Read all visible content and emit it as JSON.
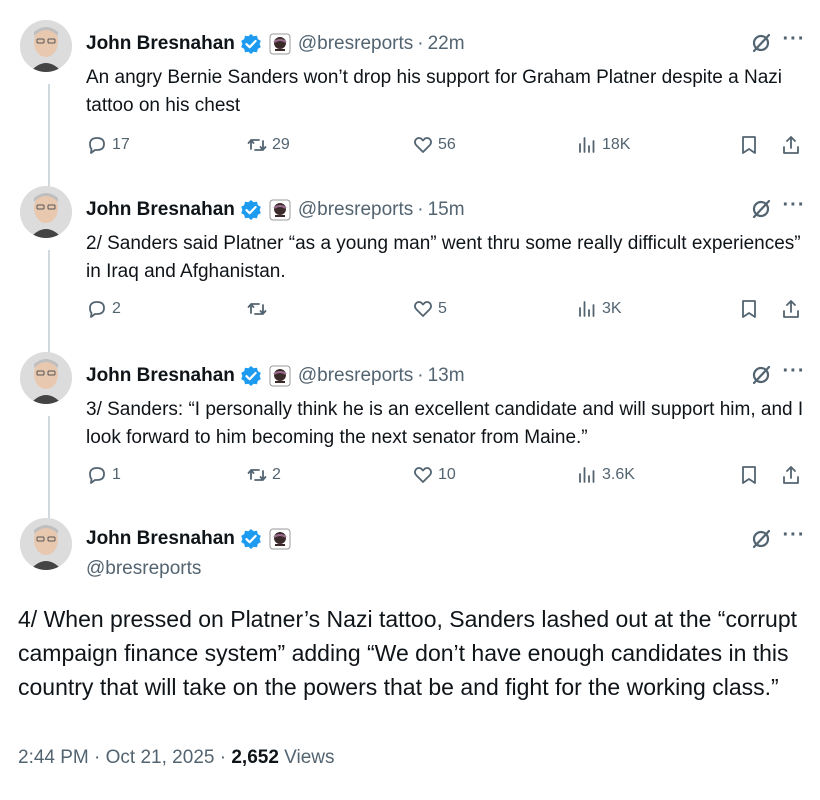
{
  "author": {
    "name": "John Bresnahan",
    "handle": "@bresreports"
  },
  "colors": {
    "verified_blue": "#1d9bf0",
    "secondary_text": "#536471",
    "primary_text": "#0f1419",
    "thread_line": "#cfd9de"
  },
  "tweets": [
    {
      "time": "22m",
      "text": "An angry Bernie Sanders won’t drop his support for Graham Platner despite a Nazi tattoo on his chest",
      "replies": "17",
      "reposts": "29",
      "likes": "56",
      "views": "18K"
    },
    {
      "time": "15m",
      "text": "2/ Sanders said Platner “as a young man” went thru some really difficult experiences” in Iraq and Afghanistan.",
      "replies": "2",
      "reposts": "",
      "likes": "5",
      "views": "3K"
    },
    {
      "time": "13m",
      "text": "3/ Sanders: “I personally think he is an excellent candidate and will support him, and I look forward to him becoming the next senator from Maine.”",
      "replies": "1",
      "reposts": "2",
      "likes": "10",
      "views": "3.6K"
    }
  ],
  "detail": {
    "text": "4/ When pressed on Platner’s Nazi tattoo, Sanders lashed out at the “corrupt campaign finance system” adding “We don’t have enough candidates in this country that will take on the powers that be and fight for the working class.”",
    "time": "2:44 PM",
    "date": "Oct 21, 2025",
    "views_count": "2,652",
    "views_label": "Views"
  },
  "icons": {
    "verified": "verified-badge-icon",
    "affiliation": "affiliation-badge-icon",
    "grok": "grok-icon",
    "more": "more-icon",
    "reply": "reply-icon",
    "repost": "repost-icon",
    "like": "like-icon",
    "views": "views-icon",
    "bookmark": "bookmark-icon",
    "share": "share-icon"
  }
}
